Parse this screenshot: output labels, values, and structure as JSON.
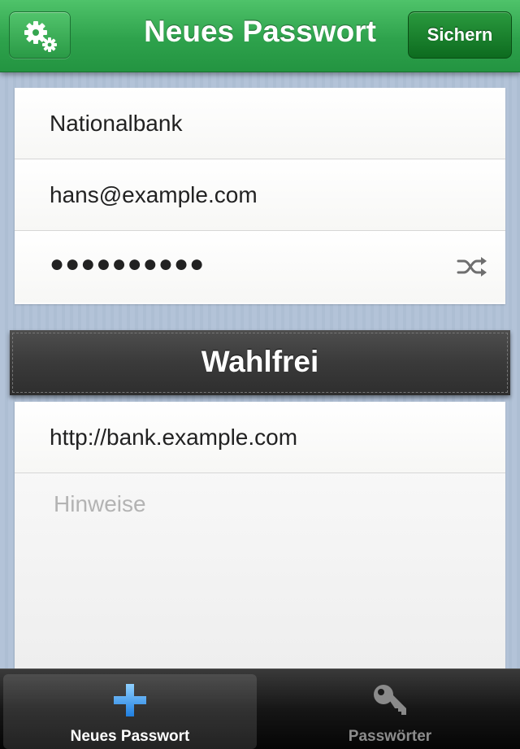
{
  "navbar": {
    "title": "Neues Passwort",
    "save_label": "Sichern",
    "settings_icon": "gears-icon",
    "color": "#2ea24c"
  },
  "account": {
    "name": "Nationalbank",
    "username": "hans@example.com",
    "password_masked": "●●●●●●●●●●",
    "generate_icon": "shuffle-icon"
  },
  "optional": {
    "header": "Wahlfrei",
    "url": "http://bank.example.com",
    "notes_placeholder": "Hinweise"
  },
  "tabbar": {
    "tabs": [
      {
        "label": "Neues Passwort",
        "icon": "plus-icon",
        "selected": true
      },
      {
        "label": "Passwörter",
        "icon": "key-icon",
        "selected": false
      }
    ]
  }
}
